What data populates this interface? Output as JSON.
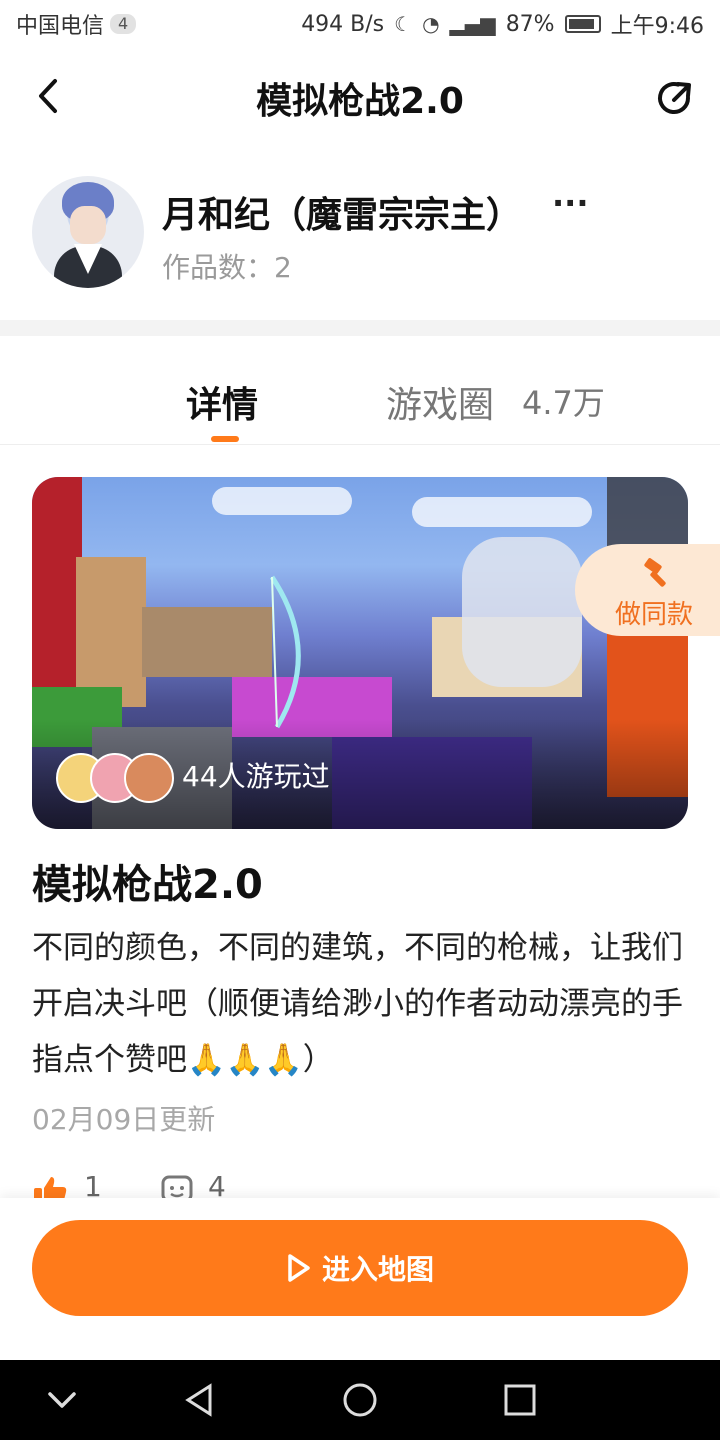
{
  "status_bar": {
    "carrier": "中国电信",
    "sim_badge": "4",
    "net_speed": "494 B/s",
    "battery": "87%",
    "time": "上午9:46"
  },
  "header": {
    "title": "模拟枪战2.0"
  },
  "author": {
    "name": "月和纪（魔雷宗宗主）",
    "more": "···",
    "works_label": "作品数：",
    "works_count": "2"
  },
  "tabs": {
    "detail": "详情",
    "game_circle": "游戏圈",
    "game_circle_count": "4.7万"
  },
  "banner": {
    "played_text": "44人游玩过"
  },
  "remix": {
    "label": "做同款"
  },
  "game": {
    "title": "模拟枪战2.0",
    "description": "不同的颜色，不同的建筑，不同的枪械，让我们开启决斗吧（顺便请给渺小的作者动动漂亮的手指点个赞吧🙏🙏🙏）",
    "updated": "02月09日更新"
  },
  "stats": {
    "likes": "1",
    "comments": "4"
  },
  "primary_action": {
    "label": "进入地图"
  },
  "colors": {
    "accent": "#ff7a1a",
    "remix_bg": "#fde8d4"
  }
}
